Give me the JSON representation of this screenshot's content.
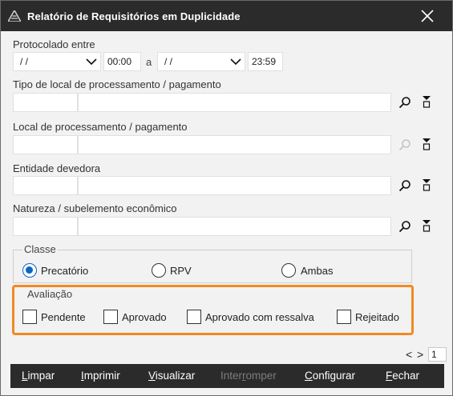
{
  "window": {
    "title": "Relatório de Requisitórios em Duplicidade",
    "close_label": "✕"
  },
  "protocolado": {
    "label": "Protocolado entre",
    "date_from": "/ /",
    "time_from": "00:00",
    "between": "a",
    "date_to": "/ /",
    "time_to": "23:59"
  },
  "tipo_local": {
    "label": "Tipo de local de processamento / pagamento",
    "code": "",
    "description": ""
  },
  "local": {
    "label": "Local de processamento / pagamento",
    "code": "",
    "description": ""
  },
  "entidade": {
    "label": "Entidade devedora",
    "code": "",
    "description": ""
  },
  "natureza": {
    "label": "Natureza / subelemento econômico",
    "code": "",
    "description": ""
  },
  "classe": {
    "title": "Classe",
    "options": [
      "Precatório",
      "RPV",
      "Ambas"
    ],
    "selected": "Precatório"
  },
  "avaliacao": {
    "title": "Avaliação",
    "options": [
      "Pendente",
      "Aprovado",
      "Aprovado com ressalva",
      "Rejeitado"
    ],
    "checked": []
  },
  "pager": {
    "prev": "<",
    "next": ">",
    "page": "1"
  },
  "buttons": {
    "limpar": {
      "first": "L",
      "rest": "impar"
    },
    "imprimir": {
      "first": "I",
      "rest": "mprimir"
    },
    "visualizar": {
      "first": "V",
      "rest": "isualizar"
    },
    "interromper": {
      "pre": "Inter",
      "u": "r",
      "post": "omper"
    },
    "configurar": {
      "first": "C",
      "rest": "onfigurar"
    },
    "fechar": {
      "first": "F",
      "rest": "echar"
    }
  },
  "colors": {
    "titlebar": "#2b2b2b",
    "highlight": "#f08a24",
    "radio_selected": "#0a66c2"
  },
  "icons": {
    "search": "search-icon",
    "clear": "clear-filter-icon",
    "dropdown": "chevron-down-icon",
    "close": "close-icon",
    "app": "app-logo-icon"
  }
}
